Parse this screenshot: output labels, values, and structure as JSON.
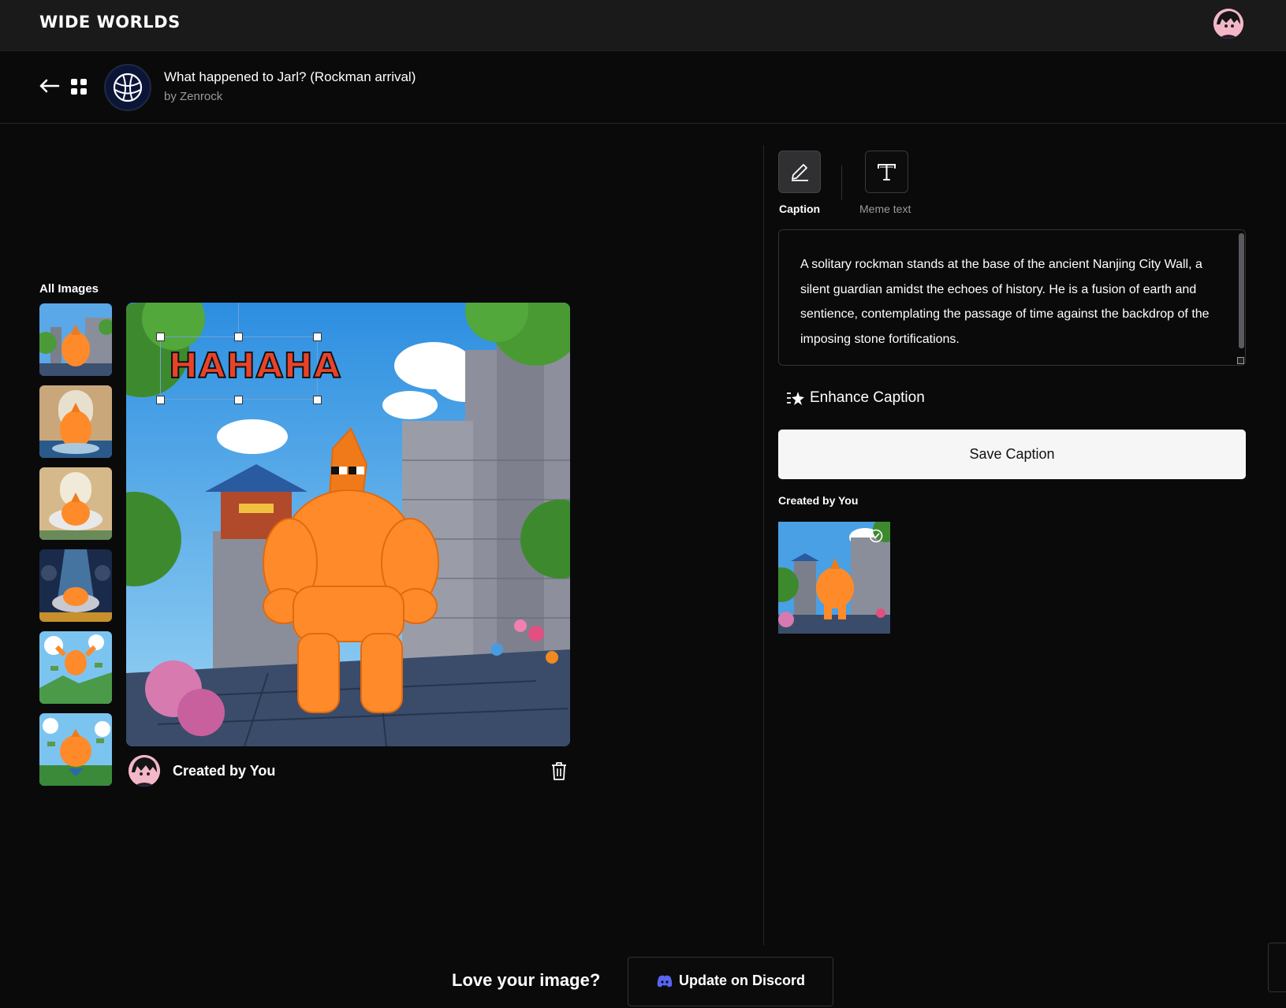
{
  "app": {
    "logo_text": "WIDE WORLDS"
  },
  "world": {
    "title": "What happened to Jarl? (Rockman arrival)",
    "author": "by Zenrock"
  },
  "gallery": {
    "label": "All Images"
  },
  "canvas": {
    "meme_text": "HAHAHA",
    "creator_name": "Created by You"
  },
  "tools": {
    "caption_label": "Caption",
    "meme_label": "Meme text"
  },
  "caption": {
    "text": "A solitary rockman stands at the base of the ancient Nanjing City Wall, a silent guardian amidst the echoes of history. He is a fusion of earth and sentience, contemplating the passage of time against the backdrop of the imposing stone fortifications."
  },
  "actions": {
    "enhance_label": "Enhance Caption",
    "save_label": "Save Caption"
  },
  "created": {
    "label": "Created by You"
  },
  "footer": {
    "prompt": "Love your image?",
    "discord_label": "Update on Discord"
  },
  "colors": {
    "meme_text": "#e8432a",
    "rockman": "#ff8a2a",
    "discord": "#5865f2"
  }
}
